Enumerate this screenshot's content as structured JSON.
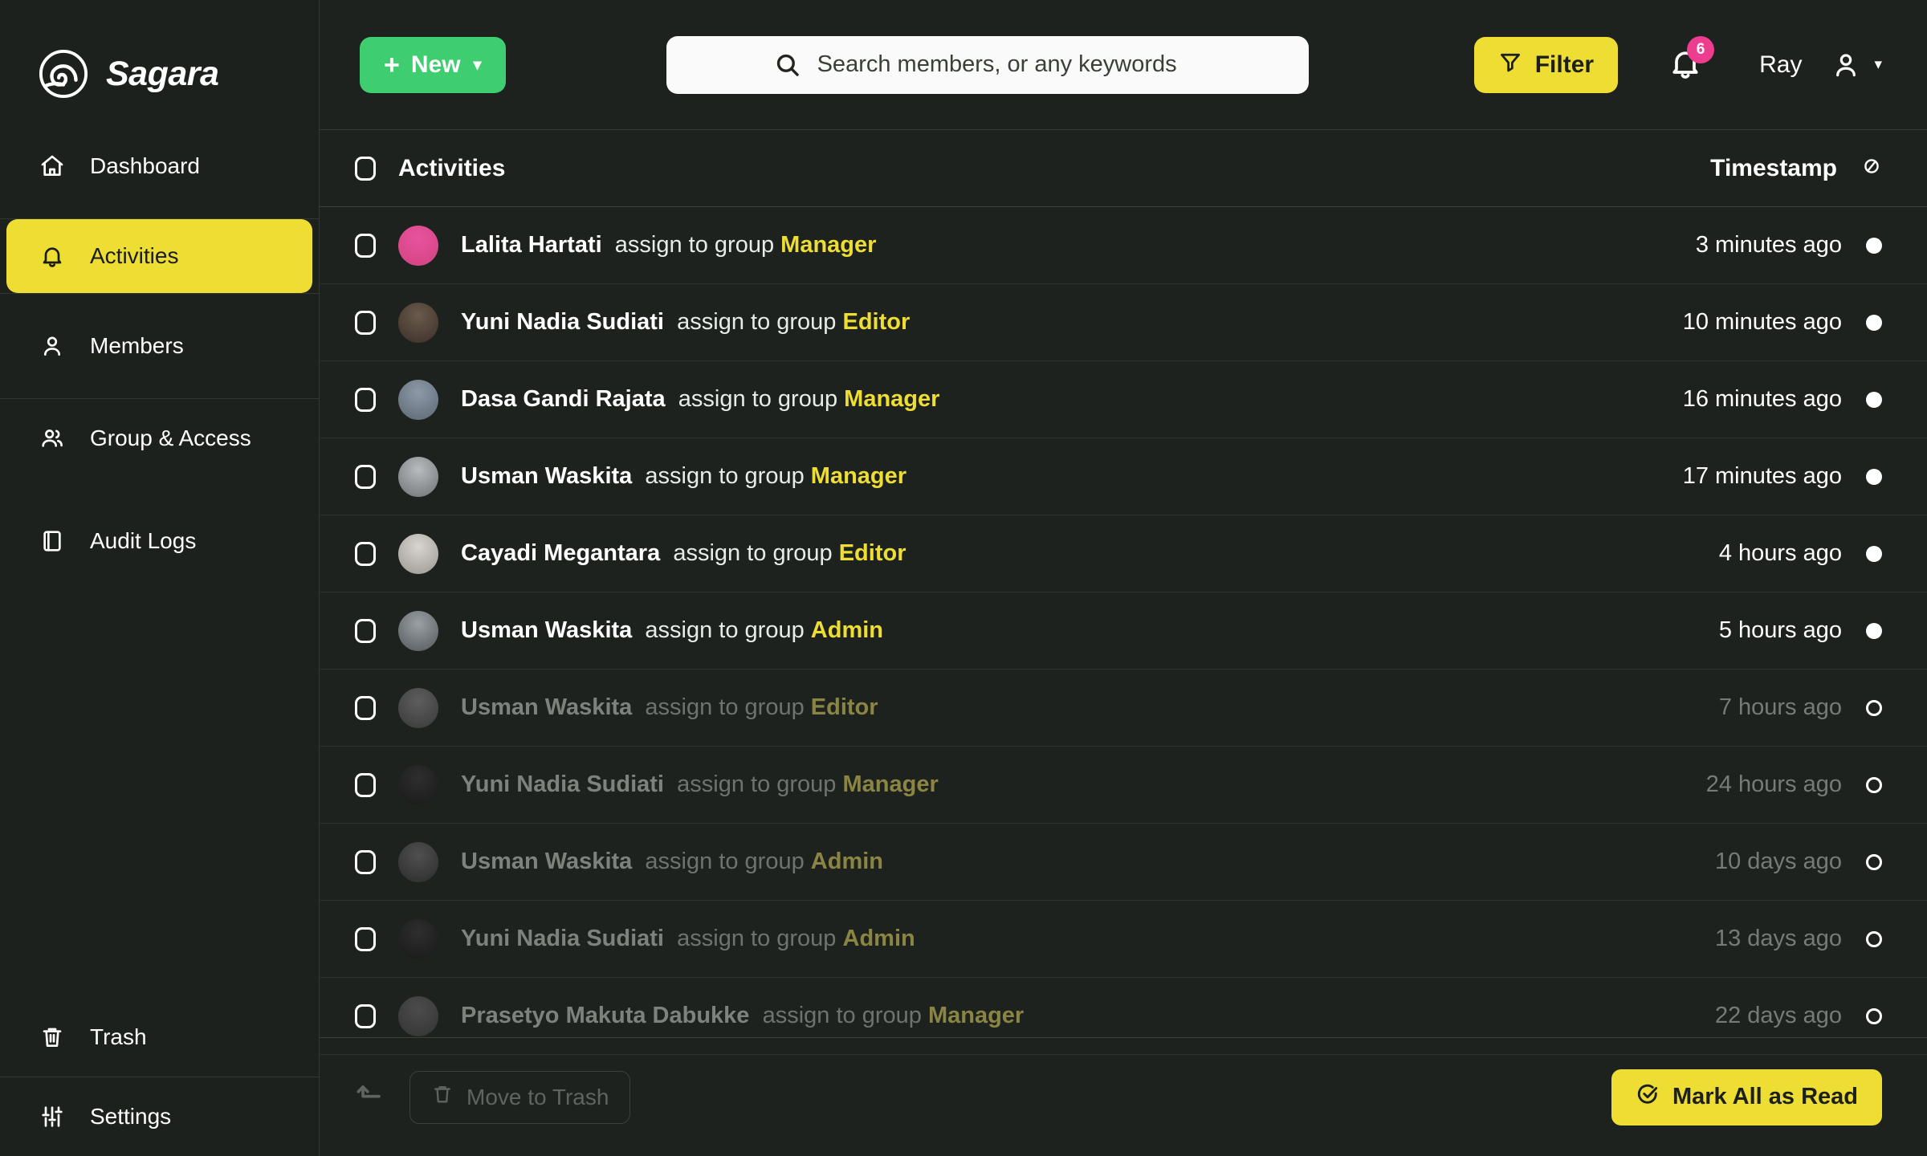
{
  "brand": {
    "name": "Sagara",
    "logo_icon": "spiral-logo-icon"
  },
  "sidebar": {
    "items": [
      {
        "label": "Dashboard",
        "icon": "home-icon",
        "active": false
      },
      {
        "label": "Activities",
        "icon": "bell-icon",
        "active": true
      },
      {
        "label": "Members",
        "icon": "user-icon",
        "active": false
      },
      {
        "label": "Group & Access",
        "icon": "users-icon",
        "active": false
      },
      {
        "label": "Audit Logs",
        "icon": "book-icon",
        "active": false
      }
    ],
    "bottom_items": [
      {
        "label": "Trash",
        "icon": "trash-icon"
      },
      {
        "label": "Settings",
        "icon": "sliders-icon"
      }
    ]
  },
  "topbar": {
    "new_label": "New",
    "new_plus": "+",
    "new_caret": "▾",
    "new_color": "#3ece70",
    "search": {
      "placeholder": "Search members, or any keywords",
      "value": "",
      "icon": "search-icon"
    },
    "filter_label": "Filter",
    "filter_icon": "funnel-icon",
    "filter_color": "#eedd33",
    "notifications": {
      "icon": "bell-icon",
      "badge": "6",
      "badge_color": "#ee3d8f"
    },
    "user": {
      "name": "Ray",
      "icon": "user-icon",
      "caret": "▾"
    }
  },
  "table": {
    "columns": {
      "activities": "Activities",
      "timestamp": "Timestamp"
    },
    "timestamp_icon": "circle-slash-icon",
    "action_text": "assign to group",
    "rows": [
      {
        "name": "Lalita Hartati",
        "action": "assign to group",
        "group": "Manager",
        "timestamp": "3 minutes ago",
        "read": false,
        "avatar_bg": "#e8539f",
        "avatar_bg2": "#d1437f"
      },
      {
        "name": "Yuni Nadia Sudiati",
        "action": "assign to group",
        "group": "Editor",
        "timestamp": "10 minutes ago",
        "read": false,
        "avatar_bg": "#6b5a4d",
        "avatar_bg2": "#3a2f27"
      },
      {
        "name": "Dasa Gandi Rajata",
        "action": "assign to group",
        "group": "Manager",
        "timestamp": "16 minutes ago",
        "read": false,
        "avatar_bg": "#8e9aa8",
        "avatar_bg2": "#5c6773"
      },
      {
        "name": "Usman Waskita",
        "action": "assign to group",
        "group": "Manager",
        "timestamp": "17 minutes ago",
        "read": false,
        "avatar_bg": "#b9bcbe",
        "avatar_bg2": "#6e7274"
      },
      {
        "name": "Cayadi Megantara",
        "action": "assign to group",
        "group": "Editor",
        "timestamp": "4 hours ago",
        "read": false,
        "avatar_bg": "#d8d4cf",
        "avatar_bg2": "#9b9791"
      },
      {
        "name": "Usman Waskita",
        "action": "assign to group",
        "group": "Admin",
        "timestamp": "5 hours ago",
        "read": false,
        "avatar_bg": "#9aa0a4",
        "avatar_bg2": "#53585c"
      },
      {
        "name": "Usman Waskita",
        "action": "assign to group",
        "group": "Editor",
        "timestamp": "7 hours ago",
        "read": true,
        "avatar_bg": "#b9bcbe",
        "avatar_bg2": "#6e7274"
      },
      {
        "name": "Yuni Nadia Sudiati",
        "action": "assign to group",
        "group": "Manager",
        "timestamp": "24 hours ago",
        "read": true,
        "avatar_bg": "#6b5a4d",
        "avatar_bg2": "#3a2f27"
      },
      {
        "name": "Usman Waskita",
        "action": "assign to group",
        "group": "Admin",
        "timestamp": "10 days ago",
        "read": true,
        "avatar_bg": "#9aa0a4",
        "avatar_bg2": "#53585c"
      },
      {
        "name": "Yuni Nadia Sudiati",
        "action": "assign to group",
        "group": "Admin",
        "timestamp": "13 days ago",
        "read": true,
        "avatar_bg": "#6b5a4d",
        "avatar_bg2": "#3a2f27"
      },
      {
        "name": "Prasetyo Makuta Dabukke",
        "action": "assign to group",
        "group": "Manager",
        "timestamp": "22 days ago",
        "read": true,
        "avatar_bg": "#8e9aa8",
        "avatar_bg2": "#5c6773"
      }
    ]
  },
  "footer": {
    "back_icon": "arrow-return-icon",
    "trash_label": "Move to Trash",
    "trash_icon": "trash-icon",
    "markread_label": "Mark All as Read",
    "markread_icon": "check-circle-icon",
    "markread_color": "#eedd33"
  }
}
